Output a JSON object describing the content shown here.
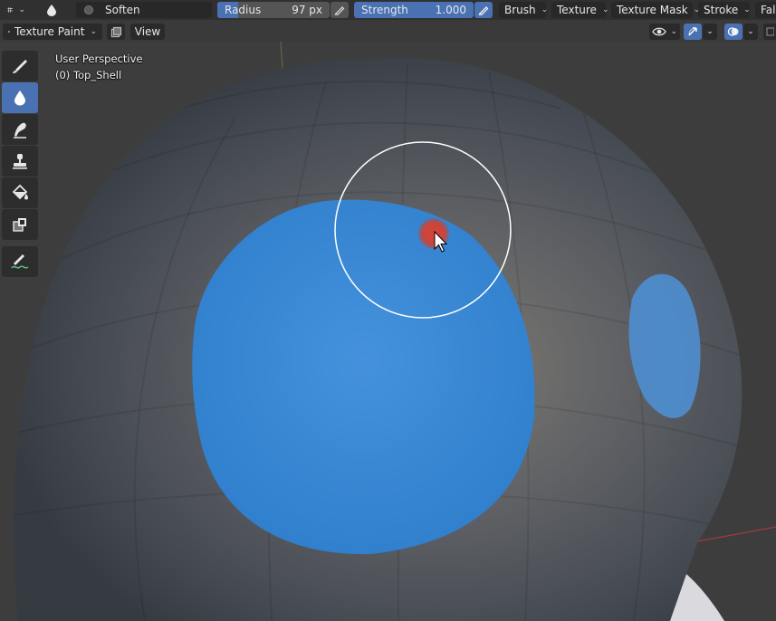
{
  "header": {
    "brush_name": "Soften",
    "radius_label": "Radius",
    "radius_value": "97 px",
    "strength_label": "Strength",
    "strength_value": "1.000",
    "strength_fraction": 1.0,
    "menus": [
      "Brush",
      "Texture",
      "Texture Mask",
      "Stroke",
      "Fal"
    ]
  },
  "subheader": {
    "mode": "Texture Paint",
    "view_menu": "View"
  },
  "viewport": {
    "perspective": "User Perspective",
    "object": "(0) Top_Shell"
  },
  "toolbar": {
    "tools": [
      "draw-brush-icon",
      "soften-icon",
      "smear-icon",
      "clone-icon",
      "fill-icon",
      "mask-icon",
      "annotate-icon"
    ],
    "active_tool": "soften-icon"
  },
  "colors": {
    "accent": "#4a72b3",
    "paint_blue": "#3b8ad6",
    "header_bg": "#303030"
  }
}
